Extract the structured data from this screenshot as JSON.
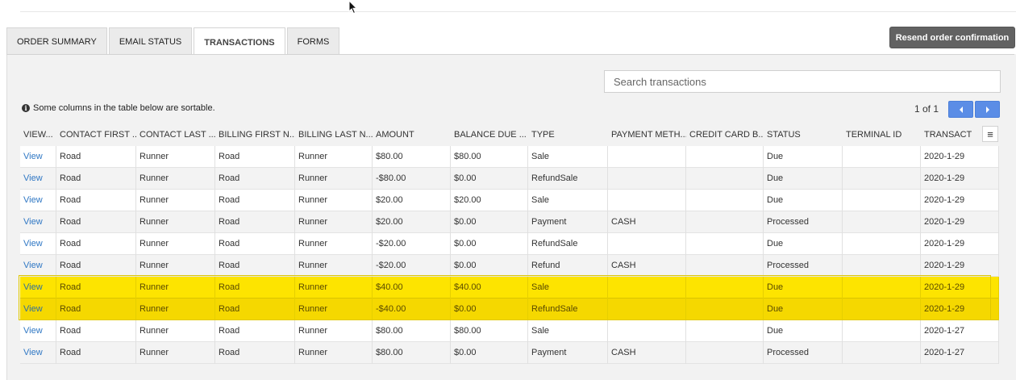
{
  "tabs": [
    {
      "label": "ORDER SUMMARY"
    },
    {
      "label": "EMAIL STATUS"
    },
    {
      "label": "TRANSACTIONS"
    },
    {
      "label": "FORMS"
    }
  ],
  "active_tab": "TRANSACTIONS",
  "resend_button": "Resend order confirmation",
  "search": {
    "placeholder": "Search transactions"
  },
  "notice": "Some columns in the table below are sortable.",
  "pager": {
    "text": "1 of 1"
  },
  "table": {
    "columns": [
      "VIEW...",
      "CONTACT FIRST ...",
      "CONTACT LAST ...",
      "BILLING FIRST N...",
      "BILLING LAST N...",
      "AMOUNT",
      "BALANCE DUE ...",
      "TYPE",
      "PAYMENT METH...",
      "CREDIT CARD B...",
      "STATUS",
      "TERMINAL ID",
      "TRANSACTIO"
    ],
    "rows": [
      [
        "View",
        "Road",
        "Runner",
        "Road",
        "Runner",
        "$80.00",
        "$80.00",
        "Sale",
        "",
        "",
        "Due",
        "",
        "2020-1-29"
      ],
      [
        "View",
        "Road",
        "Runner",
        "Road",
        "Runner",
        "-$80.00",
        "$0.00",
        "RefundSale",
        "",
        "",
        "Due",
        "",
        "2020-1-29"
      ],
      [
        "View",
        "Road",
        "Runner",
        "Road",
        "Runner",
        "$20.00",
        "$20.00",
        "Sale",
        "",
        "",
        "Due",
        "",
        "2020-1-29"
      ],
      [
        "View",
        "Road",
        "Runner",
        "Road",
        "Runner",
        "$20.00",
        "$0.00",
        "Payment",
        "CASH",
        "",
        "Processed",
        "",
        "2020-1-29"
      ],
      [
        "View",
        "Road",
        "Runner",
        "Road",
        "Runner",
        "-$20.00",
        "$0.00",
        "RefundSale",
        "",
        "",
        "Due",
        "",
        "2020-1-29"
      ],
      [
        "View",
        "Road",
        "Runner",
        "Road",
        "Runner",
        "-$20.00",
        "$0.00",
        "Refund",
        "CASH",
        "",
        "Processed",
        "",
        "2020-1-29"
      ],
      [
        "View",
        "Road",
        "Runner",
        "Road",
        "Runner",
        "$40.00",
        "$40.00",
        "Sale",
        "",
        "",
        "Due",
        "",
        "2020-1-29"
      ],
      [
        "View",
        "Road",
        "Runner",
        "Road",
        "Runner",
        "-$40.00",
        "$0.00",
        "RefundSale",
        "",
        "",
        "Due",
        "",
        "2020-1-29"
      ],
      [
        "View",
        "Road",
        "Runner",
        "Road",
        "Runner",
        "$80.00",
        "$80.00",
        "Sale",
        "",
        "",
        "Due",
        "",
        "2020-1-27"
      ],
      [
        "View",
        "Road",
        "Runner",
        "Road",
        "Runner",
        "$80.00",
        "$0.00",
        "Payment",
        "CASH",
        "",
        "Processed",
        "",
        "2020-1-27"
      ]
    ],
    "highlighted_rows": [
      6,
      7
    ]
  },
  "icons": {
    "info": "info-icon",
    "prev": "chevron-left-icon",
    "next": "chevron-right-icon",
    "columns_menu": "hamburger-menu-icon",
    "cursor": "mouse-pointer-icon"
  },
  "colors": {
    "highlight": "#fde400",
    "link": "#2f77c4",
    "pager_button": "#5b8de6",
    "resend_button": "#626262"
  }
}
